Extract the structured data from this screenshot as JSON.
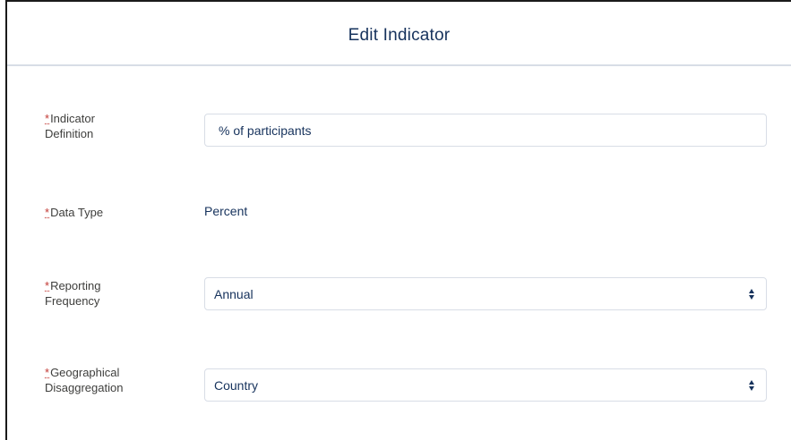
{
  "modal": {
    "title": "Edit Indicator"
  },
  "required_marker": "*",
  "fields": {
    "indicator_definition": {
      "label_line1": "Indicator",
      "label_line2": "Definition",
      "value": "% of participants"
    },
    "data_type": {
      "label": "Data Type",
      "value": "Percent"
    },
    "reporting_frequency": {
      "label_line1": "Reporting",
      "label_line2": "Frequency",
      "value": "Annual"
    },
    "geographical_disaggregation": {
      "label_line1": "Geographical",
      "label_line2": "Disaggregation",
      "value": "Country"
    }
  },
  "icons": {
    "select_toggle": "up-down-chevron-icon"
  },
  "colors": {
    "title": "#16325c",
    "required": "#c23934",
    "label": "#3e3e3c",
    "value": "#16325c",
    "border": "#d8dde6"
  }
}
